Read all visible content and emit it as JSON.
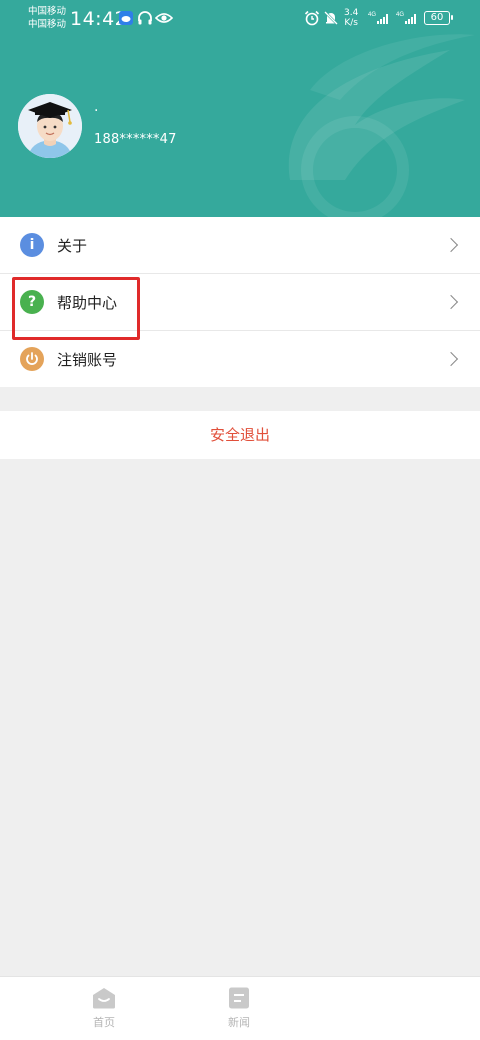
{
  "status_bar": {
    "carrier1": "中国移动",
    "carrier2": "中国移动",
    "time": "14:42",
    "net_speed_value": "3.4",
    "net_speed_unit": "K/s",
    "battery": "60",
    "icons": [
      "app-notification-icon",
      "headset-icon",
      "eye-icon",
      "alarm-icon",
      "mute-icon",
      "signal-4g-icon",
      "signal-4g-icon"
    ]
  },
  "profile": {
    "username": "·",
    "phone": "188******47"
  },
  "menu": {
    "items": [
      {
        "label": "关于",
        "icon": "info-icon",
        "color": "#5b8ee0"
      },
      {
        "label": "帮助中心",
        "icon": "help-icon",
        "color": "#49b14f"
      },
      {
        "label": "注销账号",
        "icon": "power-icon",
        "color": "#e4a35a"
      }
    ]
  },
  "logout": {
    "label": "安全退出",
    "color": "#e14f3a"
  },
  "bottom_nav": {
    "items": [
      {
        "label": "首页",
        "icon": "home-icon"
      },
      {
        "label": "新闻",
        "icon": "news-icon"
      }
    ]
  },
  "colors": {
    "header": "#35a99c",
    "highlight": "#e02a2a"
  }
}
